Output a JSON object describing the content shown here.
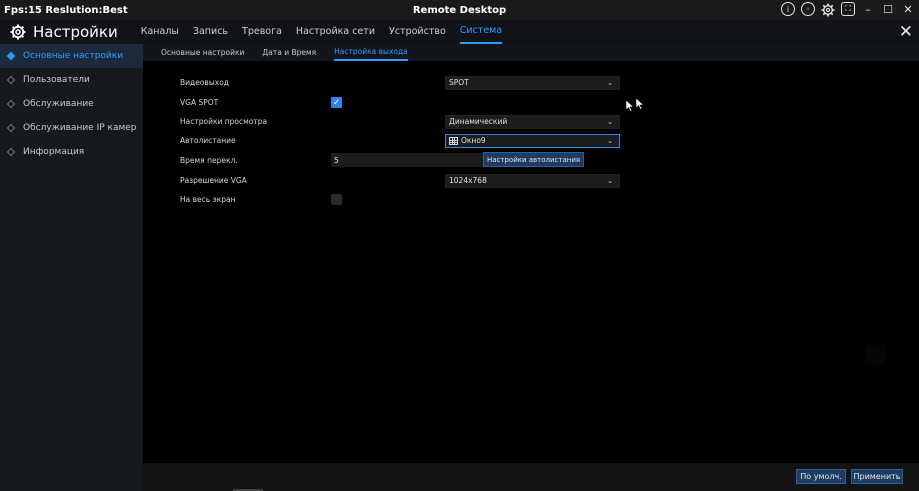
{
  "titlebar": {
    "fps_text": "Fps:15 Reslution:Best",
    "window_title": "Remote Desktop",
    "icons": [
      "info-icon",
      "record-icon",
      "gear-icon",
      "fullscreen-icon"
    ],
    "controls": {
      "minimize": "–",
      "maximize": "☐",
      "close": "✕"
    }
  },
  "header": {
    "title": "Настройки",
    "menu": [
      {
        "label": "Каналы"
      },
      {
        "label": "Запись"
      },
      {
        "label": "Тревога"
      },
      {
        "label": "Настройка сети"
      },
      {
        "label": "Устройство"
      },
      {
        "label": "Система",
        "active": true
      }
    ],
    "close_glyph": "✕"
  },
  "sidebar": {
    "items": [
      {
        "label": "Основные настройки",
        "active": true
      },
      {
        "label": "Пользователи"
      },
      {
        "label": "Обслуживание"
      },
      {
        "label": "Обслуживание IP камер"
      },
      {
        "label": "Информация"
      }
    ]
  },
  "subtabs": [
    {
      "label": "Основные настройки"
    },
    {
      "label": "Дата и Время"
    },
    {
      "label": "Настройка выхода",
      "active": true
    }
  ],
  "form": {
    "video_output": {
      "label": "Видеовыход",
      "value": "SPOT"
    },
    "vga_spot": {
      "label": "VGA SPOT",
      "checked": true
    },
    "view_setting": {
      "label": "Настройки просмотра",
      "value": "Динамический"
    },
    "auto_sequence": {
      "label": "Автолистание",
      "value": "Окно9"
    },
    "switch_time": {
      "label": "Время перекл.",
      "value": "5"
    },
    "auto_sequence_button": "Настройки автолистания",
    "vga_resolution": {
      "label": "Разрешение VGA",
      "value": "1024x768"
    },
    "fullscreen": {
      "label": "На весь экран",
      "checked": false
    }
  },
  "footer": {
    "default_button": "По умолч.",
    "apply_button": "Применить"
  },
  "colors": {
    "accent": "#2f9bff",
    "button_bg": "#1f3d63",
    "checkbox": "#2f83ea"
  }
}
